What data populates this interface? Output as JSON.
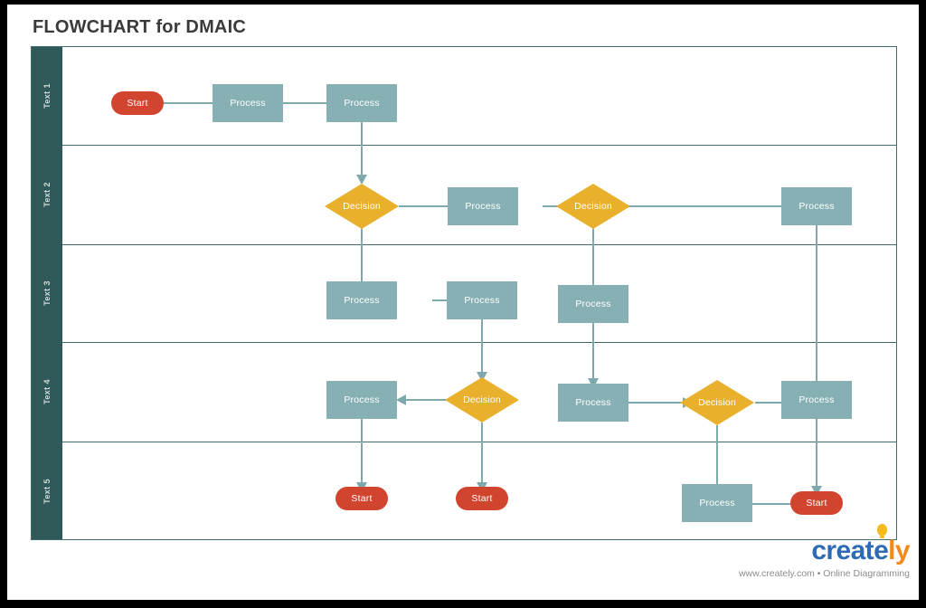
{
  "page": {
    "title": "FLOWCHART for DMAIC",
    "colors": {
      "process_fill": "#86b0b4",
      "decision_fill": "#e8b02c",
      "terminator_fill": "#d1452f",
      "lane_band": "#2f5a59",
      "connector": "#7fa8ac",
      "frame_border": "#3f6b6b",
      "title_text": "#3a3a3a",
      "canvas": "#ffffff",
      "outer_frame": "#000000"
    }
  },
  "swimlanes": [
    {
      "id": "lane1",
      "label": "Text 1"
    },
    {
      "id": "lane2",
      "label": "Text 2"
    },
    {
      "id": "lane3",
      "label": "Text 3"
    },
    {
      "id": "lane4",
      "label": "Text 4"
    },
    {
      "id": "lane5",
      "label": "Text 5"
    }
  ],
  "nodes": [
    {
      "id": "n1",
      "lane": "lane1",
      "type": "terminator",
      "label": "Start"
    },
    {
      "id": "n2",
      "lane": "lane1",
      "type": "process",
      "label": "Process"
    },
    {
      "id": "n3",
      "lane": "lane1",
      "type": "process",
      "label": "Process"
    },
    {
      "id": "n4",
      "lane": "lane2",
      "type": "decision",
      "label": "Decision"
    },
    {
      "id": "n5",
      "lane": "lane2",
      "type": "process",
      "label": "Process"
    },
    {
      "id": "n6",
      "lane": "lane2",
      "type": "decision",
      "label": "Decision"
    },
    {
      "id": "n7",
      "lane": "lane2",
      "type": "process",
      "label": "Process"
    },
    {
      "id": "n8",
      "lane": "lane3",
      "type": "process",
      "label": "Process"
    },
    {
      "id": "n9",
      "lane": "lane3",
      "type": "process",
      "label": "Process"
    },
    {
      "id": "n10",
      "lane": "lane3",
      "type": "process",
      "label": "Process"
    },
    {
      "id": "n11",
      "lane": "lane4",
      "type": "process",
      "label": "Process"
    },
    {
      "id": "n12",
      "lane": "lane4",
      "type": "decision",
      "label": "Decision"
    },
    {
      "id": "n13",
      "lane": "lane4",
      "type": "process",
      "label": "Process"
    },
    {
      "id": "n14",
      "lane": "lane4",
      "type": "decision",
      "label": "Decision"
    },
    {
      "id": "n15",
      "lane": "lane4",
      "type": "process",
      "label": "Process"
    },
    {
      "id": "n16",
      "lane": "lane5",
      "type": "terminator",
      "label": "Start"
    },
    {
      "id": "n17",
      "lane": "lane5",
      "type": "terminator",
      "label": "Start"
    },
    {
      "id": "n18",
      "lane": "lane5",
      "type": "process",
      "label": "Process"
    },
    {
      "id": "n19",
      "lane": "lane5",
      "type": "terminator",
      "label": "Start"
    }
  ],
  "edges": [
    {
      "from": "n1",
      "to": "n2",
      "direction": "right"
    },
    {
      "from": "n2",
      "to": "n3",
      "direction": "right"
    },
    {
      "from": "n3",
      "to": "n4",
      "direction": "down"
    },
    {
      "from": "n4",
      "to": "n5",
      "direction": "right"
    },
    {
      "from": "n5",
      "to": "n6",
      "direction": "right"
    },
    {
      "from": "n6",
      "to": "n7",
      "direction": "right"
    },
    {
      "from": "n4",
      "to": "n8",
      "direction": "down"
    },
    {
      "from": "n8",
      "to": "n9",
      "direction": "right"
    },
    {
      "from": "n6",
      "to": "n10",
      "direction": "down"
    },
    {
      "from": "n9",
      "to": "n12",
      "direction": "down"
    },
    {
      "from": "n12",
      "to": "n11",
      "direction": "left"
    },
    {
      "from": "n10",
      "to": "n13",
      "direction": "down"
    },
    {
      "from": "n13",
      "to": "n14",
      "direction": "right"
    },
    {
      "from": "n14",
      "to": "n15",
      "direction": "right"
    },
    {
      "from": "n7",
      "to": "n15",
      "direction": "down"
    },
    {
      "from": "n11",
      "to": "n16",
      "direction": "down"
    },
    {
      "from": "n12",
      "to": "n17",
      "direction": "down"
    },
    {
      "from": "n14",
      "to": "n18",
      "direction": "down"
    },
    {
      "from": "n18",
      "to": "n19",
      "direction": "right"
    },
    {
      "from": "n15",
      "to": "n19",
      "direction": "down"
    }
  ],
  "brand": {
    "logo_part1": "creat",
    "logo_part2": "e",
    "logo_part3": "ly",
    "tagline": "www.creately.com • Online Diagramming"
  }
}
